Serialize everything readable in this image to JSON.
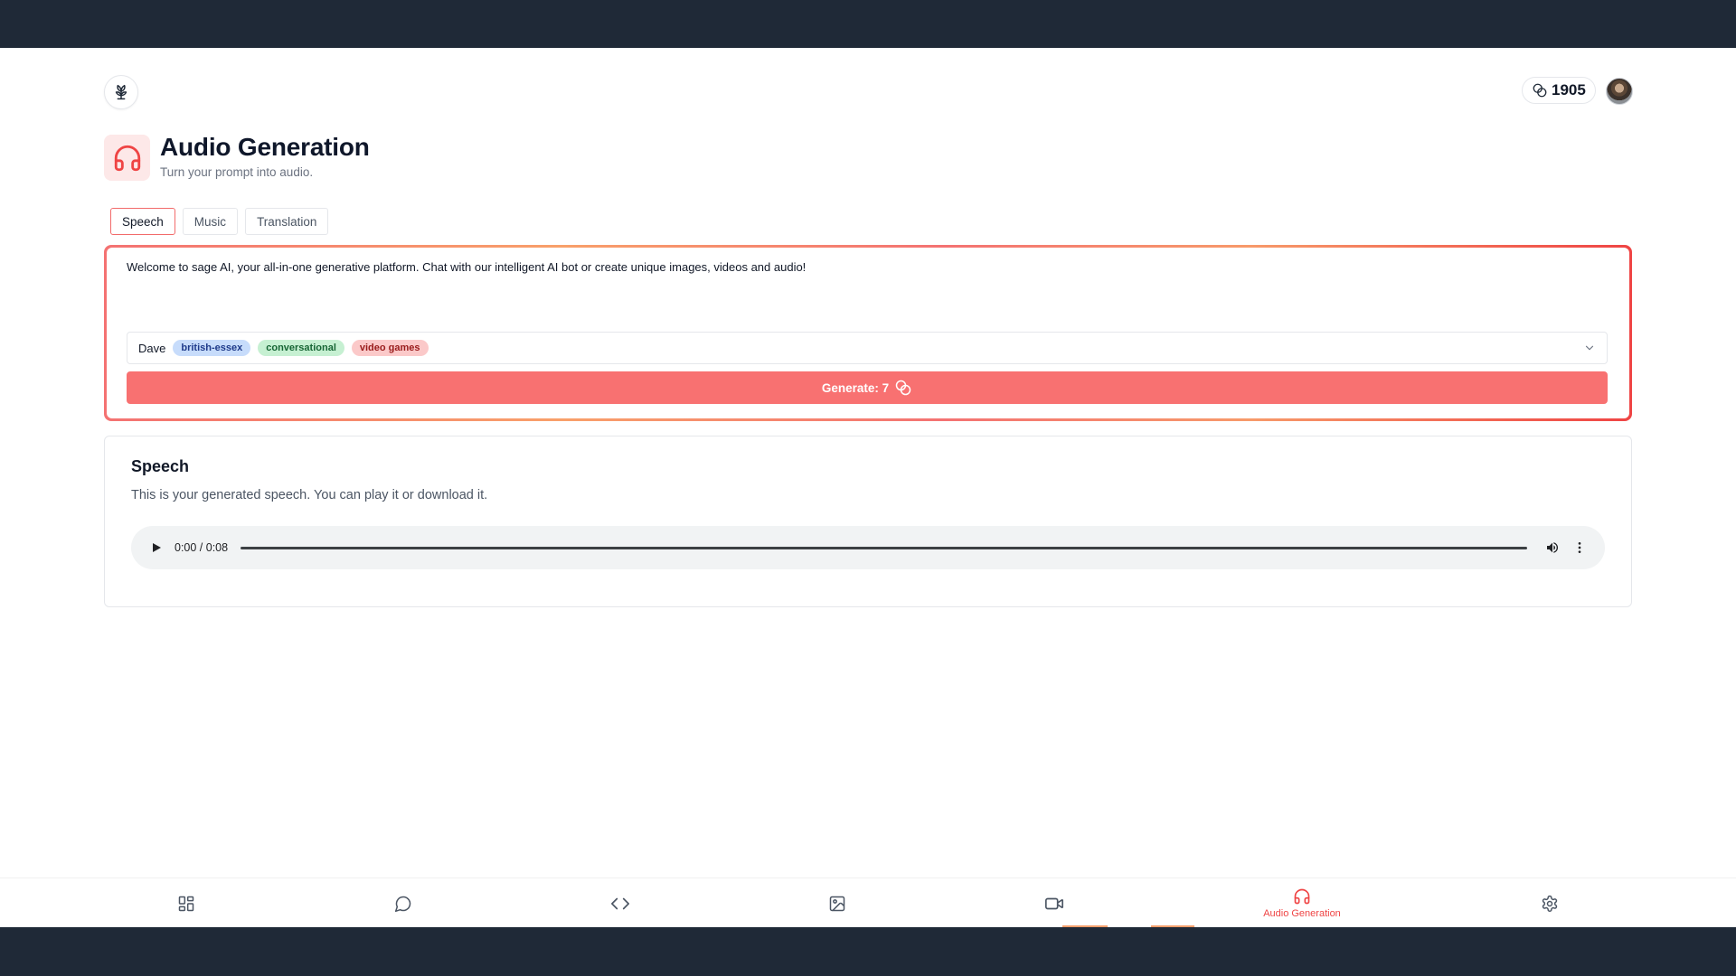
{
  "header": {
    "credits": "1905"
  },
  "page": {
    "title": "Audio Generation",
    "subtitle": "Turn your prompt into audio."
  },
  "tabs": [
    {
      "label": "Speech",
      "active": true
    },
    {
      "label": "Music",
      "active": false
    },
    {
      "label": "Translation",
      "active": false
    }
  ],
  "prompt": {
    "value": "Welcome to sage AI, your all-in-one generative platform. Chat with our intelligent AI bot or create unique images, videos and audio!"
  },
  "voice": {
    "name": "Dave",
    "tags": [
      "british-essex",
      "conversational",
      "video games"
    ]
  },
  "generate": {
    "label": "Generate: 7"
  },
  "result": {
    "title": "Speech",
    "description": "This is your generated speech. You can play it or download it.",
    "time": "0:00 / 0:08"
  },
  "bottom_nav": {
    "items": [
      {
        "icon": "dashboard-icon"
      },
      {
        "icon": "chat-icon"
      },
      {
        "icon": "code-icon"
      },
      {
        "icon": "image-icon"
      },
      {
        "icon": "video-icon"
      },
      {
        "icon": "headphones-icon",
        "label": "Audio Generation",
        "active": true
      },
      {
        "icon": "gear-icon"
      }
    ]
  },
  "colors": {
    "accent": "#ef4444",
    "button": "#f87171",
    "frame": "#1f2937"
  }
}
